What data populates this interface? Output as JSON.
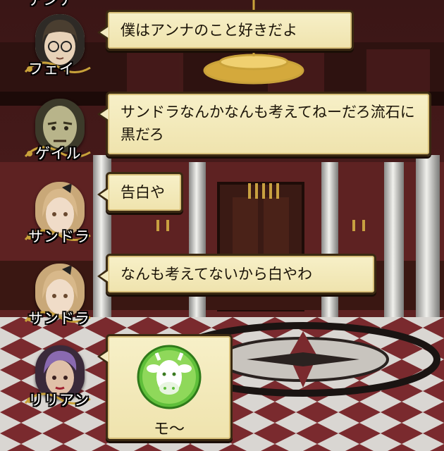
{
  "messages": [
    {
      "speaker": "フェイ",
      "text": "僕はアンナのこと好きだよ",
      "portrait": "glasses-bob-boy"
    },
    {
      "speaker": "ゲイル",
      "text": "サンドラなんかなんも考えてねーだろ流石に黒だろ",
      "portrait": "bald-old-man"
    },
    {
      "speaker": "サンドラ",
      "text": "告白や",
      "portrait": "blonde-woman-bow"
    },
    {
      "speaker": "サンドラ",
      "text": "なんも考えてないから白やわ",
      "portrait": "blonde-woman-bow"
    },
    {
      "speaker": "リリアン",
      "stamp": {
        "icon": "cow-face-icon",
        "label": "モ〜"
      },
      "portrait": "purple-hair-woman"
    }
  ],
  "partial_top_name": "アンナ",
  "colors": {
    "bubble_bg": "#f4ebc0",
    "bubble_border": "#3b2a12",
    "stamp_green": "#5fbf3a"
  }
}
